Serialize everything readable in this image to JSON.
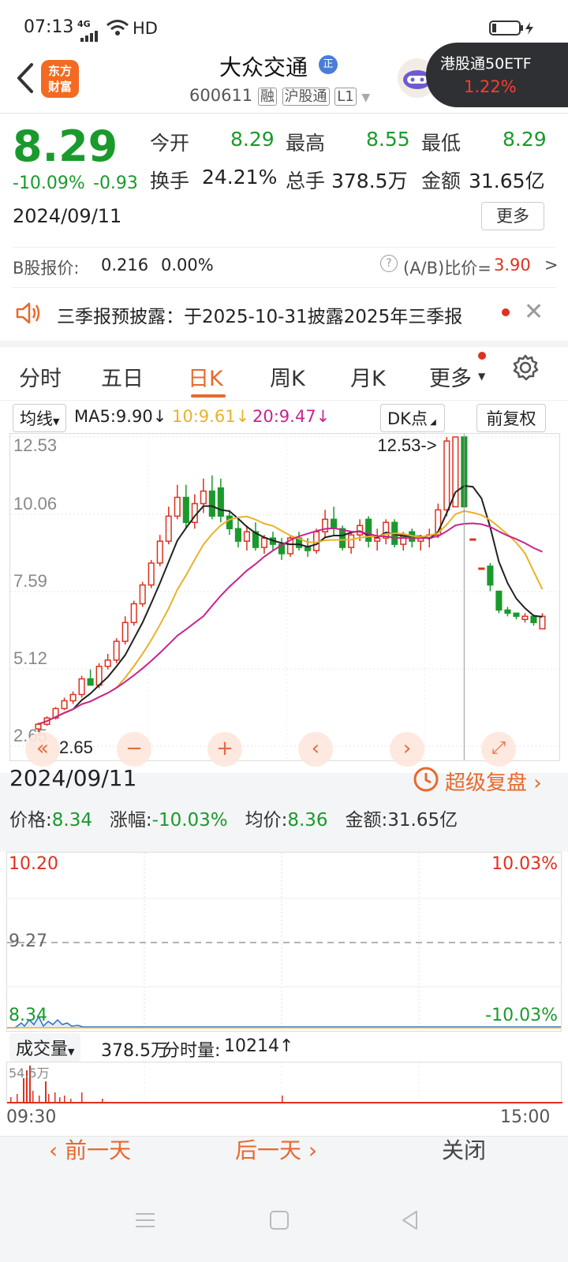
{
  "status": {
    "time": "07:13",
    "net": "4G",
    "hd": "HD"
  },
  "header": {
    "title": "大众交通",
    "badge": "正",
    "code": "600611",
    "tags": [
      "融",
      "沪股通",
      "L1"
    ],
    "logo_line1": "东方",
    "logo_line2": "财富",
    "etf_name": "港股通50ETF",
    "etf_change": "1.22%"
  },
  "quote": {
    "price": "8.29",
    "pct": "-10.09%",
    "chg": "-0.93",
    "date": "2024/09/11",
    "open_label": "今开",
    "open": "8.29",
    "high_label": "最高",
    "high": "8.55",
    "low_label": "最低",
    "low": "8.29",
    "turnover_label": "换手",
    "turnover": "24.21%",
    "vol_label": "总手",
    "vol": "378.5万",
    "amount_label": "金额",
    "amount": "31.65亿",
    "more": "更多"
  },
  "bshare": {
    "label": "B股报价:",
    "price": "0.216",
    "pct": "0.00%",
    "ratio_label": "(A/B)比价=",
    "ratio": "3.90",
    "arrow": ">"
  },
  "notice": {
    "text": "三季报预披露：于2025-10-31披露2025年三季报"
  },
  "tabs": [
    "分时",
    "五日",
    "日K",
    "周K",
    "月K",
    "更多"
  ],
  "ma": {
    "selector": "均线",
    "ma5": "MA5:9.90",
    "ma10": "10:9.61",
    "ma20": "20:9.47",
    "dk": "DK点",
    "fq": "前复权",
    "colors": {
      "ma5": "#222222",
      "ma10": "#e8b22c",
      "ma20": "#c8248c",
      "up": "#e0301e",
      "down": "#1a9a2c"
    }
  },
  "chart_data": {
    "type": "candlestick",
    "y_ticks": [
      "12.53",
      "10.06",
      "7.59",
      "5.12",
      "2.65"
    ],
    "ylim": [
      2.65,
      12.53
    ],
    "high_marker": "12.53->",
    "low_marker": "2.65",
    "candles": [
      [
        3.2,
        3.4,
        3.1,
        3.35
      ],
      [
        3.35,
        3.6,
        3.3,
        3.55
      ],
      [
        3.55,
        3.9,
        3.5,
        3.85
      ],
      [
        3.85,
        4.2,
        3.8,
        4.1
      ],
      [
        4.1,
        4.4,
        4.0,
        4.3
      ],
      [
        4.3,
        4.9,
        4.2,
        4.8
      ],
      [
        4.8,
        5.1,
        4.7,
        4.6
      ],
      [
        4.6,
        5.3,
        4.5,
        5.2
      ],
      [
        5.2,
        5.6,
        5.1,
        5.4
      ],
      [
        5.4,
        6.1,
        5.3,
        6.0
      ],
      [
        6.0,
        6.8,
        5.9,
        6.6
      ],
      [
        6.6,
        7.3,
        6.5,
        7.2
      ],
      [
        7.2,
        7.9,
        7.1,
        7.8
      ],
      [
        7.8,
        8.6,
        7.7,
        8.5
      ],
      [
        8.5,
        9.4,
        8.4,
        9.2
      ],
      [
        9.2,
        10.3,
        9.1,
        10.0
      ],
      [
        10.0,
        11.0,
        9.9,
        10.6
      ],
      [
        10.6,
        11.0,
        9.6,
        9.8
      ],
      [
        9.8,
        10.7,
        9.6,
        10.4
      ],
      [
        10.4,
        11.2,
        10.1,
        10.8
      ],
      [
        10.8,
        11.3,
        9.9,
        10.0
      ],
      [
        10.9,
        11.2,
        9.8,
        10.0
      ],
      [
        10.0,
        10.2,
        9.4,
        9.6
      ],
      [
        9.6,
        9.9,
        9.0,
        9.2
      ],
      [
        9.2,
        9.7,
        8.9,
        9.5
      ],
      [
        9.5,
        9.8,
        8.9,
        9.0
      ],
      [
        9.0,
        9.4,
        8.8,
        9.3
      ],
      [
        9.3,
        9.5,
        8.9,
        9.1
      ],
      [
        9.1,
        9.3,
        8.6,
        8.8
      ],
      [
        8.8,
        9.4,
        8.7,
        9.3
      ],
      [
        9.3,
        9.5,
        8.9,
        9.0
      ],
      [
        9.0,
        9.3,
        8.7,
        8.9
      ],
      [
        8.9,
        9.6,
        8.8,
        9.5
      ],
      [
        9.5,
        10.2,
        9.3,
        9.9
      ],
      [
        9.9,
        10.3,
        9.4,
        9.6
      ],
      [
        9.6,
        9.7,
        8.9,
        9.0
      ],
      [
        9.0,
        9.5,
        8.8,
        9.4
      ],
      [
        9.4,
        9.9,
        9.2,
        9.7
      ],
      [
        9.9,
        10.0,
        9.0,
        9.2
      ],
      [
        9.2,
        9.6,
        8.9,
        9.3
      ],
      [
        9.3,
        9.9,
        9.1,
        9.8
      ],
      [
        9.8,
        9.9,
        9.0,
        9.1
      ],
      [
        9.1,
        9.5,
        8.9,
        9.4
      ],
      [
        9.5,
        9.6,
        9.0,
        9.2
      ],
      [
        9.2,
        9.4,
        8.9,
        9.3
      ],
      [
        9.3,
        9.6,
        9.0,
        9.4
      ],
      [
        9.4,
        10.4,
        9.3,
        10.2
      ],
      [
        10.2,
        12.53,
        10.0,
        12.4
      ],
      [
        10.3,
        12.53,
        10.3,
        12.53
      ],
      [
        12.53,
        12.53,
        10.3,
        10.3
      ],
      [
        9.27,
        9.27,
        9.27,
        9.27
      ],
      [
        8.34,
        8.34,
        8.34,
        8.34
      ],
      [
        8.4,
        8.5,
        7.6,
        7.8
      ],
      [
        7.6,
        7.6,
        6.9,
        7.0
      ],
      [
        7.0,
        7.1,
        6.8,
        6.9
      ],
      [
        6.9,
        6.9,
        6.7,
        6.8
      ],
      [
        6.7,
        6.9,
        6.6,
        6.8
      ],
      [
        6.8,
        6.8,
        6.5,
        6.6
      ],
      [
        6.4,
        6.9,
        6.4,
        6.8
      ]
    ]
  },
  "minute": {
    "date": "2024/09/11",
    "super": "超级复盘",
    "price_label": "价格:",
    "price": "8.34",
    "pct_label": "涨幅:",
    "pct": "-10.03%",
    "avg_label": "均价:",
    "avg": "8.36",
    "amount_label": "金额:",
    "amount": "31.65亿",
    "y_top": "10.20",
    "y_mid": "9.27",
    "y_bot": "8.34",
    "pct_top": "10.03%",
    "pct_bot": "-10.03%"
  },
  "volume": {
    "selector": "成交量",
    "total": "378.5万",
    "minute_label": "分时量:",
    "minute": "10214↑",
    "max": "54.5万",
    "t_start": "09:30",
    "t_end": "15:00"
  },
  "bottom": {
    "prev": "前一天",
    "next": "后一天",
    "close": "关闭"
  }
}
